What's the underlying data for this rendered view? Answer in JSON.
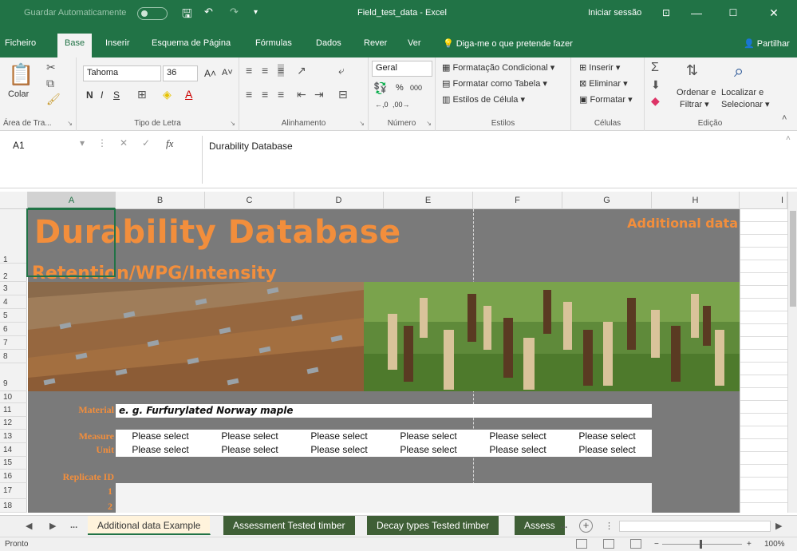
{
  "titlebar": {
    "autosave": "Guardar Automaticamente",
    "doc_title": "Field_test_data - Excel",
    "login": "Iniciar sessão"
  },
  "ribbon_tabs": [
    "Ficheiro",
    "Base",
    "Inserir",
    "Esquema de Página",
    "Fórmulas",
    "Dados",
    "Rever",
    "Ver"
  ],
  "tell_me": "Diga-me o que pretende fazer",
  "share": "Partilhar",
  "ribbon": {
    "clipboard": {
      "paste": "Colar",
      "label": "Área de Tra..."
    },
    "font": {
      "name": "Tahoma",
      "size": "36",
      "label": "Tipo de Letra"
    },
    "alignment": {
      "label": "Alinhamento"
    },
    "number": {
      "format": "Geral",
      "label": "Número"
    },
    "styles": {
      "conditional": "Formatação Condicional",
      "as_table": "Formatar como Tabela",
      "cell_styles": "Estilos de Célula",
      "label": "Estilos"
    },
    "cells": {
      "insert": "Inserir",
      "delete": "Eliminar",
      "format": "Formatar",
      "label": "Células"
    },
    "editing": {
      "sort": "Ordenar e",
      "filter": "Filtrar",
      "find": "Localizar e",
      "select": "Selecionar",
      "label": "Edição"
    }
  },
  "formula_bar": {
    "name_box": "A1",
    "content": "Durability Database"
  },
  "columns": [
    "A",
    "B",
    "C",
    "D",
    "E",
    "F",
    "G",
    "H",
    "I"
  ],
  "rows": [
    "1",
    "2",
    "3",
    "4",
    "5",
    "6",
    "7",
    "8",
    "9",
    "10",
    "11",
    "12",
    "13",
    "14",
    "15",
    "16",
    "17",
    "18"
  ],
  "sheet": {
    "title": "Durability Database",
    "subtitle": "Retention/WPG/Intensity",
    "additional": "Additional data",
    "material_label": "Material",
    "material_value": "e. g. Furfurylated Norway maple",
    "measure_label": "Measure",
    "unit_label": "Unit",
    "please_select": "Please select",
    "replicate_label": "Replicate ID",
    "replicate_1": "1",
    "replicate_2": "2"
  },
  "sheet_tabs": [
    "Additional data Example",
    "Assessment Tested timber",
    "Decay types Tested timber",
    "Assess"
  ],
  "status": {
    "ready": "Pronto",
    "zoom": "100%"
  },
  "colors": {
    "excel_green": "#217346",
    "orange": "#f28e3c",
    "sheet_gray": "#7a7a7a"
  }
}
